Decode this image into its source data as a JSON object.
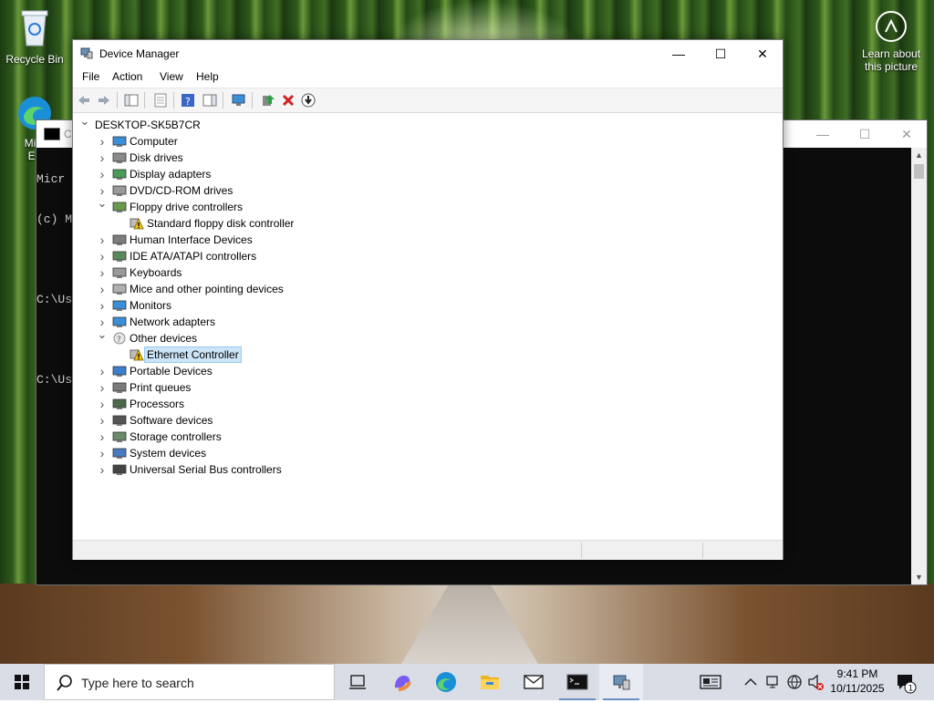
{
  "desktop": {
    "icons": [
      {
        "label": "Recycle Bin"
      },
      {
        "label": "Micr\nEd"
      }
    ],
    "learn_label": "Learn about this picture"
  },
  "console": {
    "title": "C",
    "lines": [
      "Micr",
      "(c) M",
      "",
      "C:\\Us",
      "",
      "C:\\Us"
    ],
    "buttons": {
      "min": "—",
      "max": "☐",
      "close": "✕"
    }
  },
  "device_manager": {
    "title": "Device Manager",
    "window_buttons": {
      "min": "—",
      "max": "☐",
      "close": "✕"
    },
    "menu": [
      "File",
      "Action",
      "View",
      "Help"
    ],
    "toolbar_icons": [
      "back-icon",
      "forward-icon",
      "show-hide-console-tree-icon",
      "properties-icon",
      "help-icon",
      "action-pane-icon",
      "scan-hardware-icon",
      "update-driver-icon",
      "uninstall-device-icon",
      "disable-device-icon"
    ],
    "tree": {
      "root": "DESKTOP-SK5B7CR",
      "items": [
        {
          "label": "Computer",
          "expanded": false,
          "icon": "computer-icon"
        },
        {
          "label": "Disk drives",
          "expanded": false,
          "icon": "disk-drive-icon"
        },
        {
          "label": "Display adapters",
          "expanded": false,
          "icon": "display-adapter-icon"
        },
        {
          "label": "DVD/CD-ROM drives",
          "expanded": false,
          "icon": "dvd-drive-icon"
        },
        {
          "label": "Floppy drive controllers",
          "expanded": true,
          "icon": "floppy-controller-icon",
          "children": [
            {
              "label": "Standard floppy disk controller",
              "icon": "warning-device-icon"
            }
          ]
        },
        {
          "label": "Human Interface Devices",
          "expanded": false,
          "icon": "hid-icon"
        },
        {
          "label": "IDE ATA/ATAPI controllers",
          "expanded": false,
          "icon": "ide-controller-icon"
        },
        {
          "label": "Keyboards",
          "expanded": false,
          "icon": "keyboard-icon"
        },
        {
          "label": "Mice and other pointing devices",
          "expanded": false,
          "icon": "mouse-icon"
        },
        {
          "label": "Monitors",
          "expanded": false,
          "icon": "monitor-icon"
        },
        {
          "label": "Network adapters",
          "expanded": false,
          "icon": "network-adapter-icon"
        },
        {
          "label": "Other devices",
          "expanded": true,
          "icon": "other-devices-icon",
          "children": [
            {
              "label": "Ethernet Controller",
              "icon": "warning-device-icon",
              "selected": true
            }
          ]
        },
        {
          "label": "Portable Devices",
          "expanded": false,
          "icon": "portable-device-icon"
        },
        {
          "label": "Print queues",
          "expanded": false,
          "icon": "printer-icon"
        },
        {
          "label": "Processors",
          "expanded": false,
          "icon": "processor-icon"
        },
        {
          "label": "Software devices",
          "expanded": false,
          "icon": "software-device-icon"
        },
        {
          "label": "Storage controllers",
          "expanded": false,
          "icon": "storage-controller-icon"
        },
        {
          "label": "System devices",
          "expanded": false,
          "icon": "system-device-icon"
        },
        {
          "label": "Universal Serial Bus controllers",
          "expanded": false,
          "icon": "usb-icon"
        }
      ]
    }
  },
  "taskbar": {
    "search_placeholder": "Type here to search",
    "apps": [
      "task-view-icon",
      "copilot-icon",
      "edge-icon",
      "file-explorer-icon",
      "mail-icon",
      "terminal-icon",
      "device-manager-icon"
    ],
    "clock": {
      "time": "9:41 PM",
      "date": "10/11/2025"
    },
    "notification_count": "1"
  },
  "colors": {
    "selection_bg": "#cce4f7",
    "selection_border": "#99c9ef",
    "taskbar": "#d8dde6",
    "warning": "#f2c511"
  }
}
